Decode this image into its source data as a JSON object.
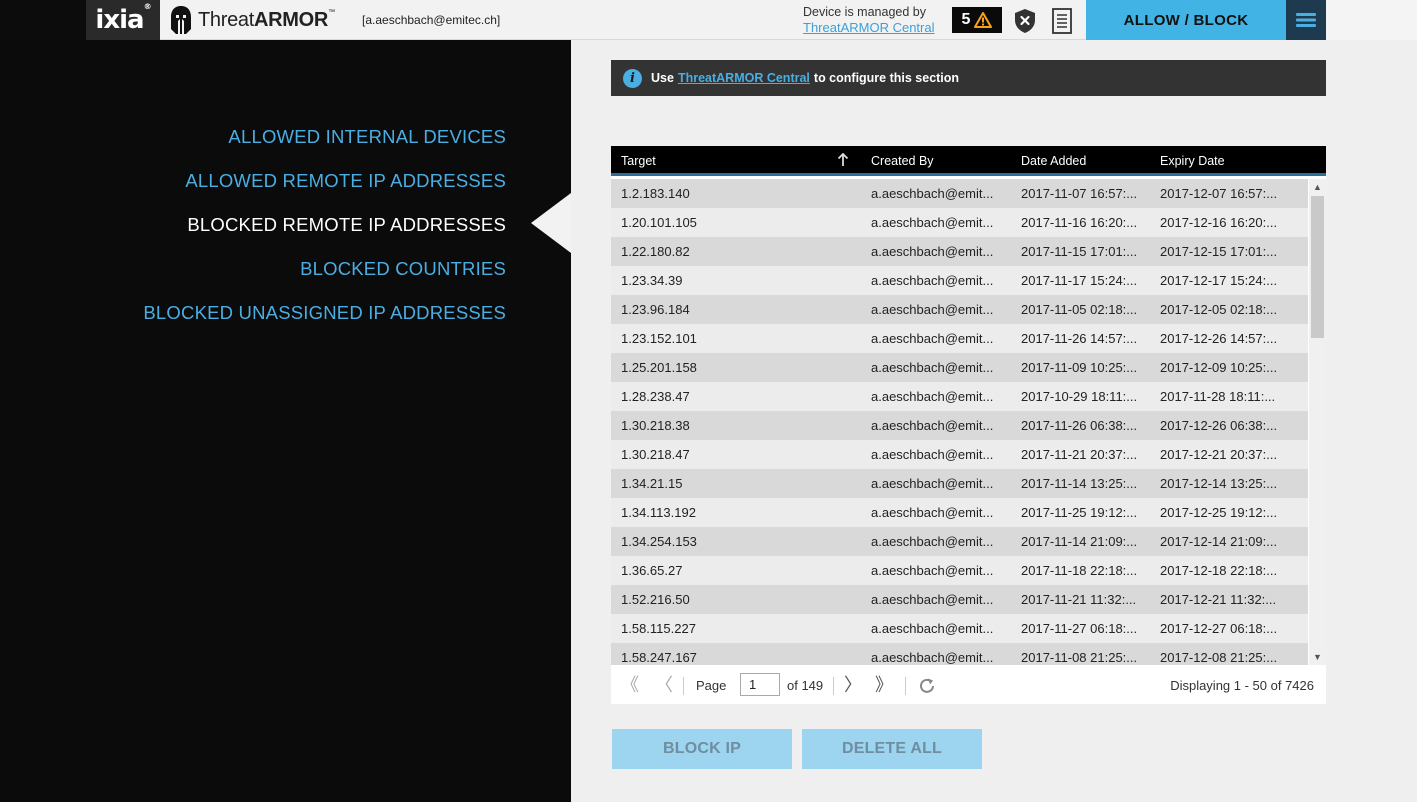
{
  "header": {
    "brand": "ixia",
    "brand_mark": "®",
    "product_prefix": "Threat",
    "product_suffix": "ARMOR",
    "product_mark": "™",
    "user": "[a.aeschbach@emitec.ch]",
    "managed_text": "Device is managed by",
    "managed_link": "ThreatARMOR Central",
    "alert_count": "5",
    "allow_block_label": "ALLOW / BLOCK"
  },
  "nav": {
    "items": [
      {
        "label": "ALLOWED INTERNAL DEVICES",
        "active": false
      },
      {
        "label": "ALLOWED REMOTE IP ADDRESSES",
        "active": false
      },
      {
        "label": "BLOCKED REMOTE IP ADDRESSES",
        "active": true
      },
      {
        "label": "BLOCKED COUNTRIES",
        "active": false
      },
      {
        "label": "BLOCKED UNASSIGNED IP ADDRESSES",
        "active": false
      }
    ]
  },
  "info": {
    "prefix": "Use",
    "link": "ThreatARMOR Central",
    "suffix": "to configure this section"
  },
  "table": {
    "columns": [
      "Target",
      "Created By",
      "Date Added",
      "Expiry Date"
    ],
    "rows": [
      [
        "1.2.183.140",
        "a.aeschbach@emit...",
        "2017-11-07 16:57:...",
        "2017-12-07 16:57:..."
      ],
      [
        "1.20.101.105",
        "a.aeschbach@emit...",
        "2017-11-16 16:20:...",
        "2017-12-16 16:20:..."
      ],
      [
        "1.22.180.82",
        "a.aeschbach@emit...",
        "2017-11-15 17:01:...",
        "2017-12-15 17:01:..."
      ],
      [
        "1.23.34.39",
        "a.aeschbach@emit...",
        "2017-11-17 15:24:...",
        "2017-12-17 15:24:..."
      ],
      [
        "1.23.96.184",
        "a.aeschbach@emit...",
        "2017-11-05 02:18:...",
        "2017-12-05 02:18:..."
      ],
      [
        "1.23.152.101",
        "a.aeschbach@emit...",
        "2017-11-26 14:57:...",
        "2017-12-26 14:57:..."
      ],
      [
        "1.25.201.158",
        "a.aeschbach@emit...",
        "2017-11-09 10:25:...",
        "2017-12-09 10:25:..."
      ],
      [
        "1.28.238.47",
        "a.aeschbach@emit...",
        "2017-10-29 18:11:...",
        "2017-11-28 18:11:..."
      ],
      [
        "1.30.218.38",
        "a.aeschbach@emit...",
        "2017-11-26 06:38:...",
        "2017-12-26 06:38:..."
      ],
      [
        "1.30.218.47",
        "a.aeschbach@emit...",
        "2017-11-21 20:37:...",
        "2017-12-21 20:37:..."
      ],
      [
        "1.34.21.15",
        "a.aeschbach@emit...",
        "2017-11-14 13:25:...",
        "2017-12-14 13:25:..."
      ],
      [
        "1.34.113.192",
        "a.aeschbach@emit...",
        "2017-11-25 19:12:...",
        "2017-12-25 19:12:..."
      ],
      [
        "1.34.254.153",
        "a.aeschbach@emit...",
        "2017-11-14 21:09:...",
        "2017-12-14 21:09:..."
      ],
      [
        "1.36.65.27",
        "a.aeschbach@emit...",
        "2017-11-18 22:18:...",
        "2017-12-18 22:18:..."
      ],
      [
        "1.52.216.50",
        "a.aeschbach@emit...",
        "2017-11-21 11:32:...",
        "2017-12-21 11:32:..."
      ],
      [
        "1.58.115.227",
        "a.aeschbach@emit...",
        "2017-11-27 06:18:...",
        "2017-12-27 06:18:..."
      ],
      [
        "1.58.247.167",
        "a.aeschbach@emit...",
        "2017-11-08 21:25:...",
        "2017-12-08 21:25:..."
      ]
    ]
  },
  "pager": {
    "page_label": "Page",
    "current_page": "1",
    "of_label": "of 149",
    "display_info": "Displaying 1 - 50 of 7426"
  },
  "actions": {
    "block_ip": "BLOCK IP",
    "delete_all": "DELETE ALL"
  },
  "colors": {
    "accent": "#42b3e5",
    "nav_link": "#4aaee3",
    "dark": "#0b0b0b",
    "button_disabled": "#9dd4ef"
  },
  "icons": {
    "helmet": "spartan-helmet-icon",
    "alert": "warning-triangle-icon",
    "shield": "shield-x-icon",
    "document": "document-list-icon",
    "menu": "hamburger-menu-icon",
    "info": "info-icon",
    "sort": "sort-ascending-icon",
    "first": "first-page-icon",
    "prev": "previous-page-icon",
    "next": "next-page-icon",
    "last": "last-page-icon",
    "refresh": "refresh-icon"
  }
}
